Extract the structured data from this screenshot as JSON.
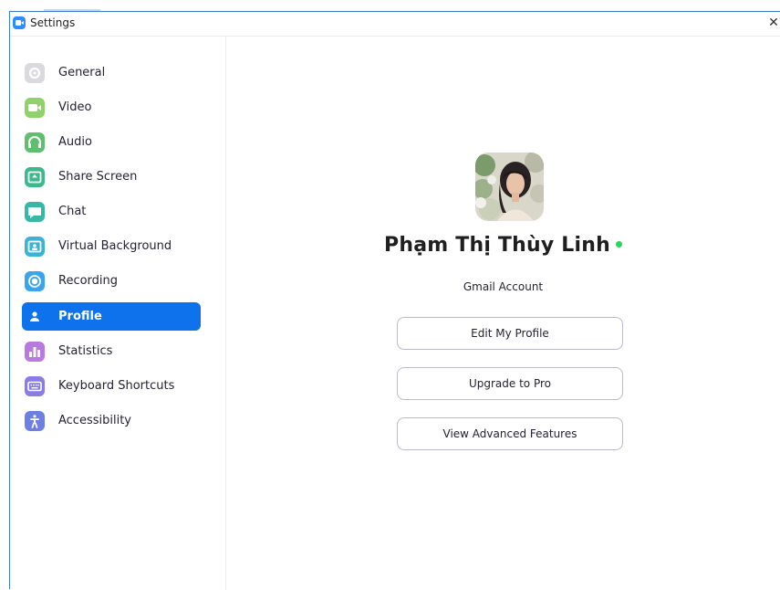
{
  "window": {
    "title": "Settings",
    "close_glyph": "✕"
  },
  "sidebar": {
    "items": [
      {
        "label": "General",
        "icon": "gear-icon",
        "color": "#d9d9de"
      },
      {
        "label": "Video",
        "icon": "video-camera-icon",
        "color": "#8fd16a"
      },
      {
        "label": "Audio",
        "icon": "headphones-icon",
        "color": "#5fbf6f"
      },
      {
        "label": "Share Screen",
        "icon": "share-screen-icon",
        "color": "#3cb98c"
      },
      {
        "label": "Chat",
        "icon": "chat-bubble-icon",
        "color": "#39b7a6"
      },
      {
        "label": "Virtual Background",
        "icon": "person-background-icon",
        "color": "#3ab3d6"
      },
      {
        "label": "Recording",
        "icon": "record-icon",
        "color": "#3aa5ec"
      },
      {
        "label": "Profile",
        "icon": "person-icon",
        "color": "#0e72ed",
        "active": true
      },
      {
        "label": "Statistics",
        "icon": "bar-chart-icon",
        "color": "#b67ae0"
      },
      {
        "label": "Keyboard Shortcuts",
        "icon": "keyboard-icon",
        "color": "#8a7be5"
      },
      {
        "label": "Accessibility",
        "icon": "accessibility-icon",
        "color": "#6e7fe4"
      }
    ]
  },
  "profile": {
    "name": "Phạm Thị Thùy Linh",
    "status_color": "#23d959",
    "account_type": "Gmail Account",
    "buttons": {
      "edit": "Edit My Profile",
      "upgrade": "Upgrade to Pro",
      "advanced": "View Advanced Features"
    }
  }
}
